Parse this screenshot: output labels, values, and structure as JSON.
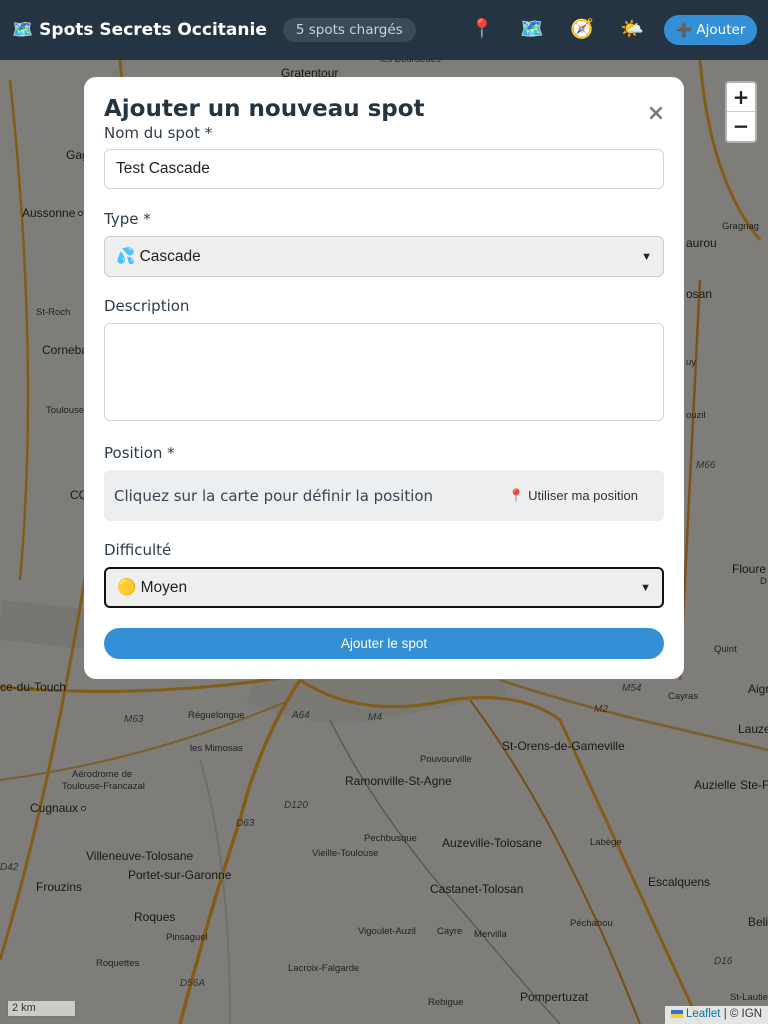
{
  "header": {
    "app_icon": "map-icon",
    "app_title": "Spots Secrets Occitanie",
    "spots_badge": "5 spots chargés",
    "tools": [
      {
        "icon": "pin-icon",
        "glyph": "📍"
      },
      {
        "icon": "map-icon",
        "glyph": "🗺️"
      },
      {
        "icon": "compass-tool-icon",
        "glyph": "🧭"
      },
      {
        "icon": "weather-icon",
        "glyph": "🌤️"
      }
    ],
    "add_label": "Ajouter",
    "add_icon": "➕"
  },
  "map": {
    "labels": [
      "Gratentour",
      "les Bourdettes",
      "Aussonne",
      "St-Roch",
      "Cornebarrieu",
      "Toulouse",
      "Quint",
      "Cayras",
      "ce-du-Touch",
      "Réguelongue",
      "les Mimosas",
      "Aérodrome de Toulouse-Francazal",
      "Cugnaux",
      "Villeneuve-Tolosane",
      "Portet-sur-Garonne",
      "Frouzins",
      "Roques",
      "Pinsaguel",
      "Roquettes",
      "Lacroix-Falgarde",
      "Vigoulet-Auzil",
      "Cayre",
      "Mervilla",
      "Rebigue",
      "Pompertuzat",
      "Pechbusque",
      "Vieille-Toulouse",
      "Ramonville-St-Agne",
      "Pouvourville",
      "Auzeville-Tolosane",
      "Castanet-Tolosan",
      "St-Orens-de-Gameville",
      "Labège",
      "Escalquens",
      "Péchabou",
      "Auzielle",
      "Lauze",
      "Floure",
      "Gragnag",
      "aurou",
      "osan",
      "ouzil",
      "St-Lautier",
      "Beli",
      "Aigr",
      "Ste-F",
      "CO",
      "Gag",
      "M66",
      "M54",
      "M2",
      "M63",
      "A64",
      "M4",
      "D120",
      "D63",
      "D56A",
      "D16",
      "D42",
      "uy",
      "D"
    ],
    "scale": "2 km",
    "attribution_link": "Leaflet",
    "attribution_rest": "| © IGN",
    "zoom_in": "+",
    "zoom_out": "−"
  },
  "modal": {
    "title": "Ajouter un nouveau spot",
    "close_label": "×",
    "name_label": "Nom du spot *",
    "name_value": "Test Cascade",
    "type_label": "Type *",
    "type_value": "💦 Cascade",
    "description_label": "Description",
    "description_value": "",
    "position_label": "Position *",
    "position_hint": "Cliquez sur la carte pour définir la position",
    "geo_button": "Utiliser ma position",
    "geo_icon": "📍",
    "difficulty_label": "Difficulté",
    "difficulty_value": "🟡 Moyen",
    "submit_label": "Ajouter le spot"
  },
  "colors": {
    "header_bg": "#243442",
    "accent": "#3390d6",
    "title": "#243442"
  }
}
